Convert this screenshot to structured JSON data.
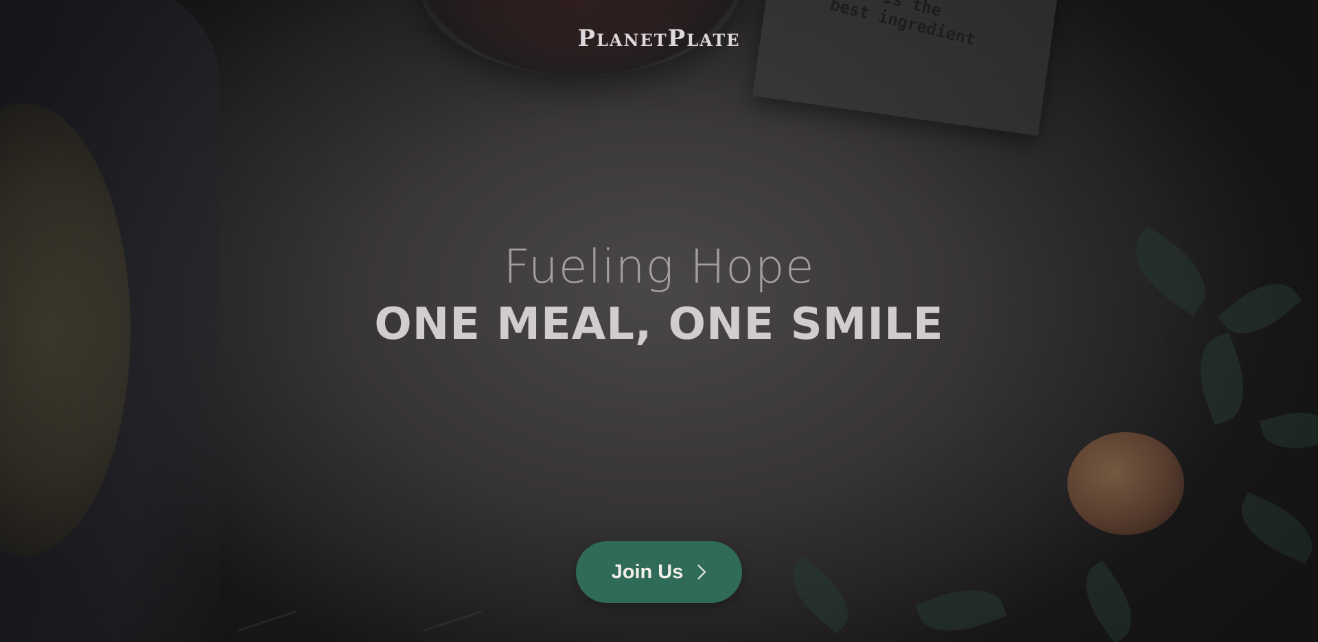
{
  "brand": {
    "name": "PlanetPlate"
  },
  "hero": {
    "tagline": "Fueling Hope",
    "headline": "ONE MEAL, ONE SMILE",
    "cta": {
      "label": "Join Us",
      "icon": "chevron-right-icon"
    },
    "background_note": "...e is the\nbest ingredient"
  },
  "colors": {
    "accent": "#2f6b58",
    "brand_text": "#ded7db",
    "tagline_text": "#a39fa1",
    "headline_text": "#d2cbcf"
  }
}
